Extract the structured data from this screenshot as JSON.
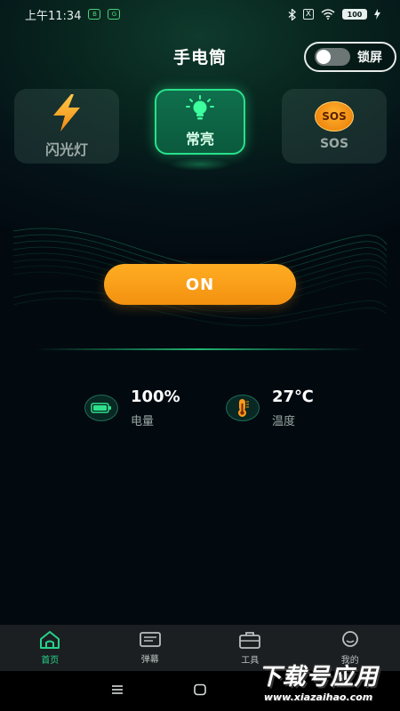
{
  "status_bar": {
    "time": "上午11:34",
    "badge_1": "B",
    "badge_2": "G",
    "sim": "X",
    "battery": "100"
  },
  "header": {
    "title": "手电筒",
    "lock_label": "锁屏",
    "lock_on": false
  },
  "modes": [
    {
      "label": "闪光灯",
      "icon": "lightning-icon",
      "active": false
    },
    {
      "label": "常亮",
      "icon": "bulb-icon",
      "active": true
    },
    {
      "label": "SOS",
      "icon": "sos-icon",
      "active": false,
      "icon_text": "SOS"
    }
  ],
  "power_button": {
    "label": "ON"
  },
  "stats": {
    "battery": {
      "value": "100%",
      "label": "电量"
    },
    "temperature": {
      "value": "27℃",
      "label": "温度"
    }
  },
  "bottom_nav": [
    {
      "label": "首页",
      "icon": "home-icon",
      "active": true
    },
    {
      "label": "弹幕",
      "icon": "danmaku-icon",
      "active": false
    },
    {
      "label": "工具",
      "icon": "toolbox-icon",
      "active": false
    },
    {
      "label": "我的",
      "icon": "profile-icon",
      "active": false
    }
  ],
  "watermark": {
    "main": "下载号应用",
    "sub": "www.xiazaihao.com"
  },
  "colors": {
    "accent": "#27d28a",
    "on_button": "#f39110",
    "background": "#030b12"
  }
}
